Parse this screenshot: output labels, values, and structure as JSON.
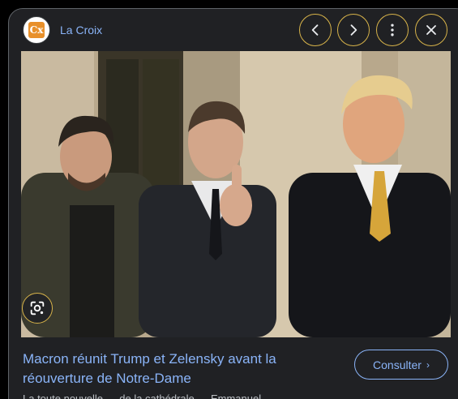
{
  "source": {
    "name": "La Croix",
    "logo_text": "Cx"
  },
  "header_buttons": {
    "prev_icon": "chevron-left-icon",
    "next_icon": "chevron-right-icon",
    "more_icon": "more-vert-icon",
    "close_icon": "close-icon"
  },
  "image": {
    "alt": "Zelensky, Macron et Trump à l'Élysée"
  },
  "lens_icon": "google-lens-icon",
  "headline": "Macron réunit Trump et Zelensky avant la réouverture de Notre-Dame",
  "consult_button": {
    "label": "Consulter",
    "icon": "chevron-right-icon"
  },
  "snippet": "La toute nouvelle … de la cathédrale … Emmanuel"
}
